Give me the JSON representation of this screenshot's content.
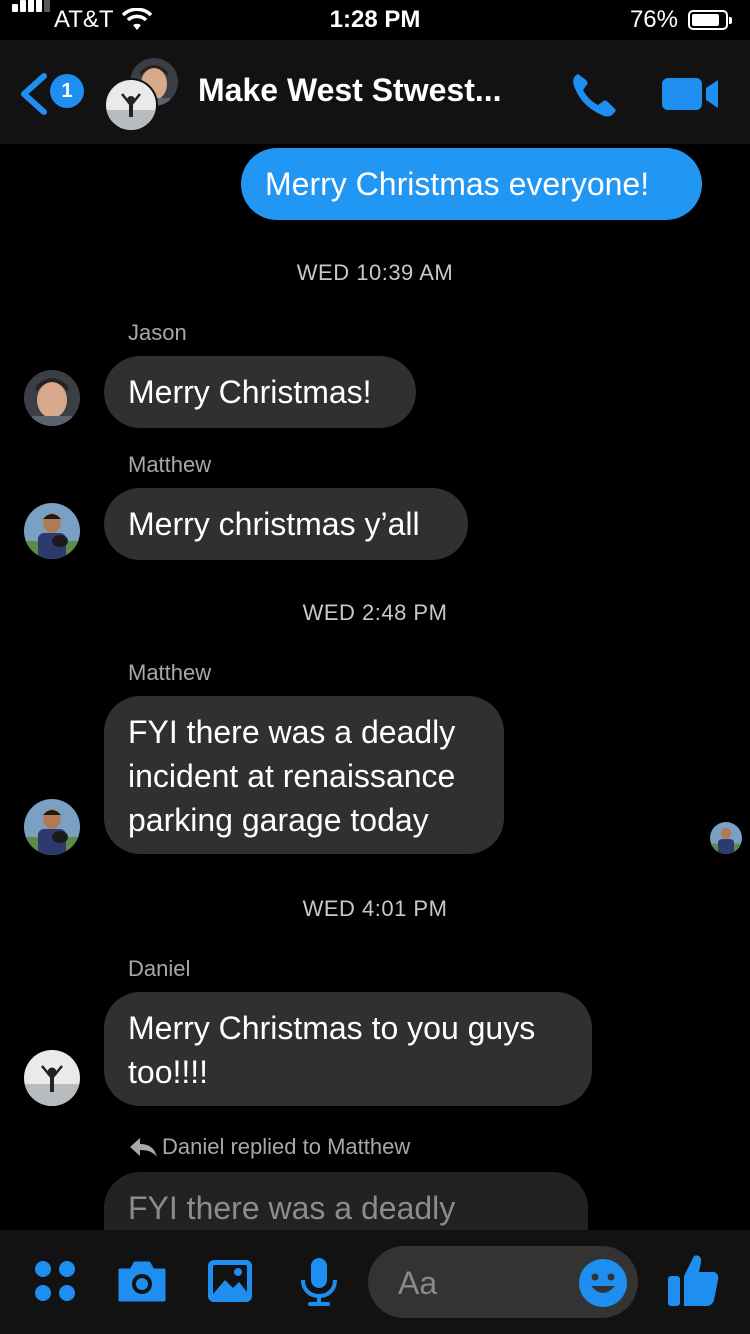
{
  "status_bar": {
    "carrier": "AT&T",
    "time": "1:28 PM",
    "battery": "76%"
  },
  "header": {
    "back_badge": "1",
    "title": "Make West Stwest...",
    "icons": [
      "back-chevron-icon",
      "phone-icon",
      "video-camera-icon"
    ]
  },
  "messages": {
    "outgoing_1": "Merry Christmas everyone!",
    "ts_1": "WED 10:39 AM",
    "sender_1": "Jason",
    "msg_1": "Merry Christmas!",
    "sender_2": "Matthew",
    "msg_2": "Merry christmas y’all",
    "ts_2": "WED 2:48 PM",
    "sender_3": "Matthew",
    "msg_3_line1": "FYI there was a deadly",
    "msg_3_line2": "incident at renaissance",
    "msg_3_line3": "parking garage today",
    "ts_3": "WED 4:01 PM",
    "sender_4": "Daniel",
    "msg_4_line1": "Merry Christmas to you guys",
    "msg_4_line2": "too!!!!",
    "reply_label": "Daniel replied to Matthew",
    "quoted_preview": "FYI there was a deadly incident"
  },
  "composer": {
    "placeholder": "Aa",
    "icons": [
      "apps-grid-icon",
      "camera-icon",
      "gallery-icon",
      "microphone-icon",
      "emoji-icon",
      "thumbs-up-icon"
    ]
  },
  "colors": {
    "accent": "#2196f3",
    "bubble_theirs": "#303030",
    "background": "#000000"
  }
}
